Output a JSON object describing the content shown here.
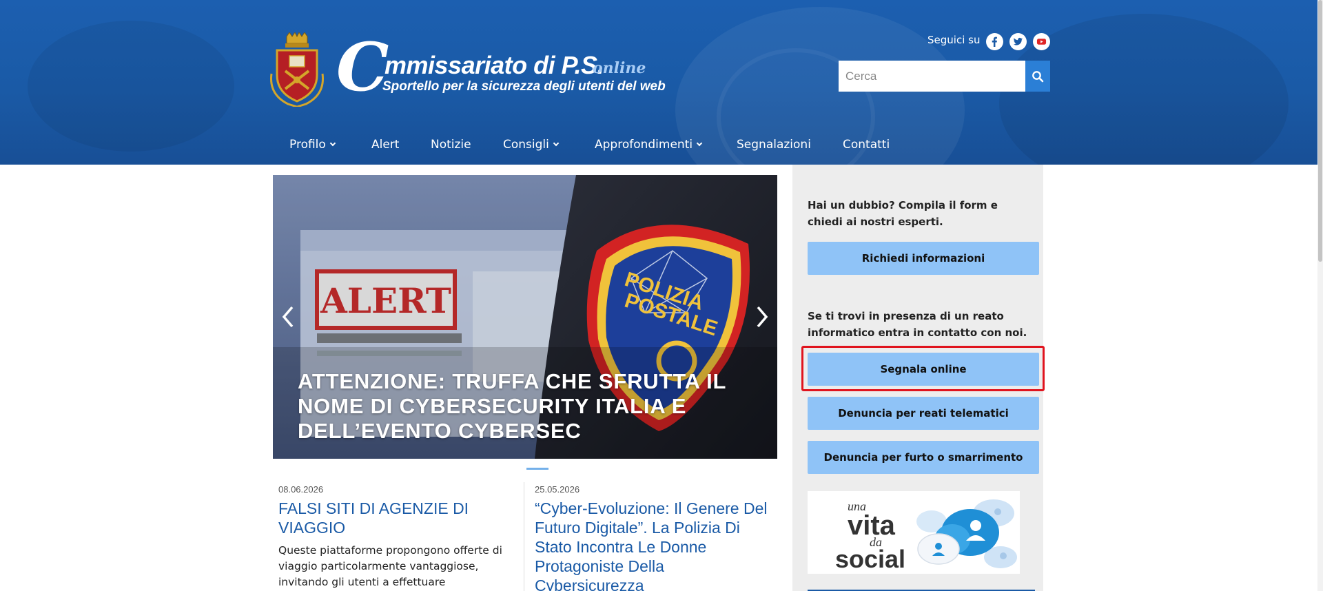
{
  "header": {
    "logo": {
      "c_letter": "C",
      "word": "mmissariato di P.S.",
      "online": "online",
      "subtitle": "Sportello per la sicurezza degli utenti del web"
    },
    "social": {
      "label": "Seguici su",
      "items": [
        "facebook-icon",
        "twitter-icon",
        "youtube-icon"
      ]
    },
    "search": {
      "placeholder": "Cerca"
    },
    "nav": [
      {
        "label": "Profilo",
        "dropdown": true
      },
      {
        "label": "Alert",
        "dropdown": false
      },
      {
        "label": "Notizie",
        "dropdown": false
      },
      {
        "label": "Consigli",
        "dropdown": true
      },
      {
        "label": "Approfondimenti",
        "dropdown": true
      },
      {
        "label": "Segnalazioni",
        "dropdown": false
      },
      {
        "label": "Contatti",
        "dropdown": false
      }
    ]
  },
  "carousel": {
    "title": "ATTENZIONE: TRUFFA CHE SFRUTTA IL NOME DI CYBERSECURITY ITALIA E DELL’EVENTO CYBERSEC",
    "photo_alert": "ALERT",
    "photo_badge": [
      "POLIZIA",
      "POSTALE"
    ]
  },
  "news": [
    {
      "date": "08.06.2026",
      "title": "FALSI SITI DI AGENZIE DI VIAGGIO",
      "text": "Queste piattaforme propongono offerte di viaggio particolarmente vantaggiose, invitando gli utenti a effettuare prenotazioni o"
    },
    {
      "date": "25.05.2026",
      "title": "“Cyber-Evoluzione: Il Genere Del Futuro Digitale”. La Polizia Di Stato Incontra Le Donne Protagoniste Della Cybersicurezza",
      "text": ""
    }
  ],
  "sidebar": {
    "info_text": "Hai un dubbio? Compila il form e chiedi ai nostri esperti.",
    "info_button": "Richiedi informazioni",
    "report_text": "Se ti trovi in presenza di un reato informatico entra in contatto con noi.",
    "buttons": [
      "Segnala online",
      "Denuncia per reati telematici",
      "Denuncia per furto o smarrimento"
    ],
    "banner": {
      "line1": "una",
      "line2": "vita",
      "line3": "da",
      "line4": "social"
    }
  },
  "colors": {
    "header_blue": "#1a5aa6",
    "button_light_blue": "#8fc3f7",
    "search_button": "#2b7fd6",
    "highlight_red": "#e0141e",
    "link_blue": "#1a5aa6"
  }
}
